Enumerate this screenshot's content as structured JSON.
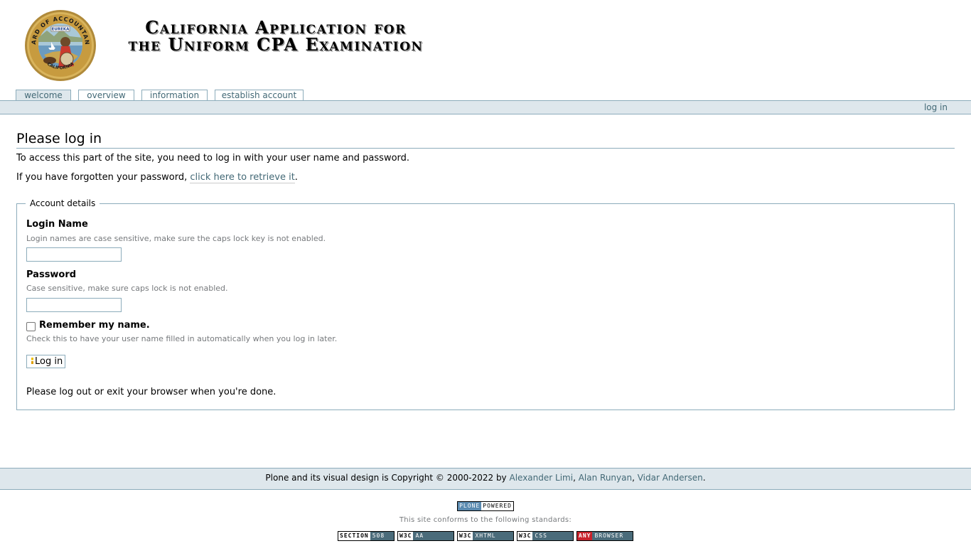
{
  "header": {
    "seal_text": "BOARD OF ACCOUNTANCY",
    "seal_motto": "EUREKA",
    "seal_bottom": "CALIFORNIA",
    "title_line1": "California Application for",
    "title_line2": "the Uniform CPA Examination"
  },
  "tabs": [
    {
      "label": "welcome",
      "selected": true
    },
    {
      "label": "overview",
      "selected": false
    },
    {
      "label": "information",
      "selected": false
    },
    {
      "label": "establish account",
      "selected": false
    }
  ],
  "personal_bar": {
    "login_label": "log in"
  },
  "content": {
    "title": "Please log in",
    "intro": "To access this part of the site, you need to log in with your user name and password.",
    "forgot_prefix": "If you have forgotten your password, ",
    "forgot_link": "click here to retrieve it",
    "forgot_suffix": "."
  },
  "form": {
    "legend": "Account details",
    "login_name_label": "Login Name",
    "login_name_help": "Login names are case sensitive, make sure the caps lock key is not enabled.",
    "login_name_value": "",
    "password_label": "Password",
    "password_help": "Case sensitive, make sure caps lock is not enabled.",
    "password_value": "",
    "remember_label": "Remember my name.",
    "remember_help": "Check this to have your user name filled in automatically when you log in later.",
    "remember_checked": false,
    "submit_label": "Log in",
    "logout_note": "Please log out or exit your browser when you're done."
  },
  "footer": {
    "copyright_prefix": "Plone and its visual design is Copyright © 2000-2022 by ",
    "author1": "Alexander Limi",
    "sep1": ", ",
    "author2": "Alan Runyan",
    "sep2": ", ",
    "author3": "Vidar Andersen",
    "suffix": "."
  },
  "colophon": {
    "plone_badge_a": "PLONE",
    "plone_badge_b": "POWERED",
    "standards_text": "This site conforms to the following standards:",
    "badges": [
      {
        "k": "SECTION",
        "v": "508"
      },
      {
        "k": "W3C",
        "v": "AA"
      },
      {
        "k": "W3C",
        "v": "XHTML"
      },
      {
        "k": "W3C",
        "v": "CSS"
      },
      {
        "k": "ANY",
        "v": "BROWSER"
      }
    ]
  },
  "colors": {
    "link": "#436976",
    "border": "#8cacbb",
    "bar_bg": "#dee7ec",
    "help_text": "#76797c"
  }
}
